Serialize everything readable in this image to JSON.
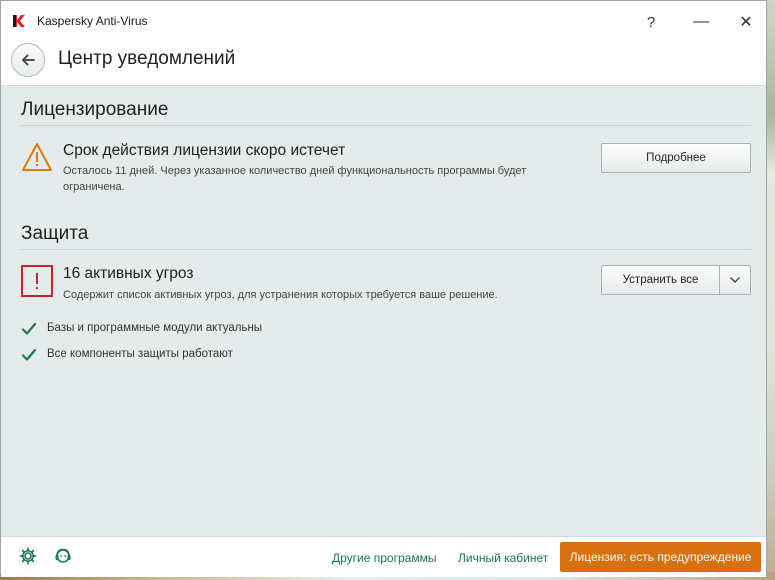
{
  "window": {
    "title": "Kaspersky Anti-Virus"
  },
  "titlebar": {
    "help_label": "?",
    "minimize_label": "—",
    "close_label": "✕"
  },
  "header": {
    "title": "Центр уведомлений"
  },
  "licensing": {
    "section_title": "Лицензирование",
    "item_title": "Срок действия лицензии скоро истечет",
    "item_desc_line1": "Осталось 11 дней. Через указанное количество дней функциональность программы будет",
    "item_desc_line2": "ограничена.",
    "details_button": "Подробнее",
    "icon": "warning-triangle-icon"
  },
  "protection": {
    "section_title": "Защита",
    "threats_title": "16 активных угроз",
    "threats_desc": "Содержит список активных угроз, для устранения которых требуется ваше решение.",
    "fix_all_button": "Устранить все",
    "status_items": [
      {
        "label": "Базы и программные модули актуальны",
        "icon": "check-icon"
      },
      {
        "label": "Все компоненты защиты работают",
        "icon": "check-icon"
      }
    ]
  },
  "footer": {
    "other_programs": "Другие программы",
    "personal_cabinet": "Личный кабинет",
    "license_button": "Лицензия: есть предупреждение"
  },
  "colors": {
    "accent_green": "#1a7a52",
    "warning_orange": "#e07a10",
    "danger_red": "#c8232c",
    "license_button_bg": "#d9700f"
  }
}
